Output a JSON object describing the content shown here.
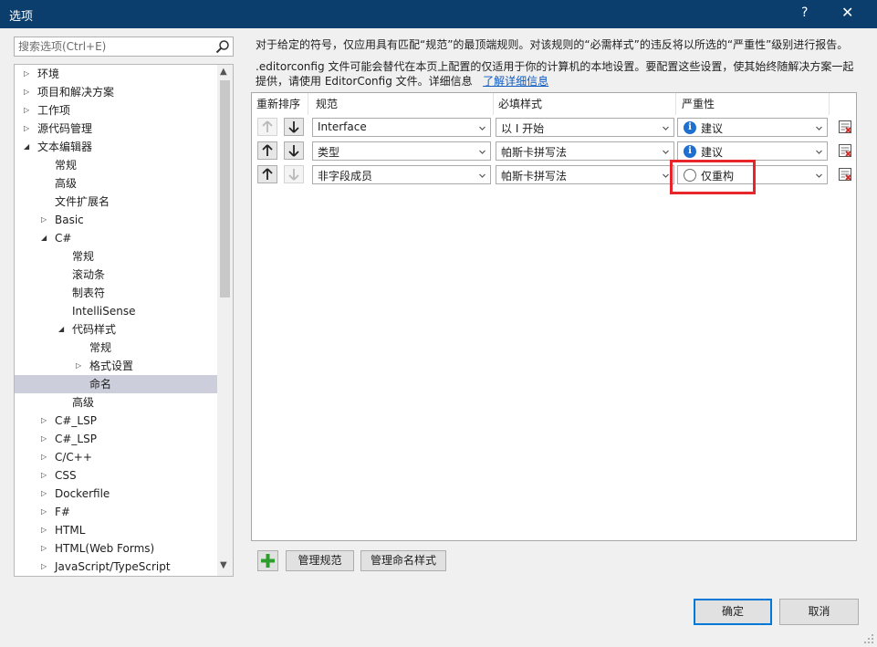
{
  "window": {
    "title": "选项",
    "help_label": "?",
    "close_label": "✕"
  },
  "search": {
    "placeholder": "搜索选项(Ctrl+E)"
  },
  "tree": {
    "items": [
      {
        "label": "环境",
        "level": 0,
        "arrow": "collapsed"
      },
      {
        "label": "项目和解决方案",
        "level": 0,
        "arrow": "collapsed"
      },
      {
        "label": "工作项",
        "level": 0,
        "arrow": "collapsed"
      },
      {
        "label": "源代码管理",
        "level": 0,
        "arrow": "collapsed"
      },
      {
        "label": "文本编辑器",
        "level": 0,
        "arrow": "expanded"
      },
      {
        "label": "常规",
        "level": 1,
        "arrow": "none"
      },
      {
        "label": "高级",
        "level": 1,
        "arrow": "none"
      },
      {
        "label": "文件扩展名",
        "level": 1,
        "arrow": "none"
      },
      {
        "label": "Basic",
        "level": 1,
        "arrow": "collapsed"
      },
      {
        "label": "C#",
        "level": 1,
        "arrow": "expanded"
      },
      {
        "label": "常规",
        "level": 2,
        "arrow": "none"
      },
      {
        "label": "滚动条",
        "level": 2,
        "arrow": "none"
      },
      {
        "label": "制表符",
        "level": 2,
        "arrow": "none"
      },
      {
        "label": "IntelliSense",
        "level": 2,
        "arrow": "none"
      },
      {
        "label": "代码样式",
        "level": 2,
        "arrow": "expanded"
      },
      {
        "label": "常规",
        "level": 3,
        "arrow": "none"
      },
      {
        "label": "格式设置",
        "level": 3,
        "arrow": "collapsed"
      },
      {
        "label": "命名",
        "level": 3,
        "arrow": "none",
        "selected": true
      },
      {
        "label": "高级",
        "level": 2,
        "arrow": "none"
      },
      {
        "label": "C#_LSP",
        "level": 1,
        "arrow": "collapsed"
      },
      {
        "label": "C#_LSP",
        "level": 1,
        "arrow": "collapsed"
      },
      {
        "label": "C/C++",
        "level": 1,
        "arrow": "collapsed"
      },
      {
        "label": "CSS",
        "level": 1,
        "arrow": "collapsed"
      },
      {
        "label": "Dockerfile",
        "level": 1,
        "arrow": "collapsed"
      },
      {
        "label": "F#",
        "level": 1,
        "arrow": "collapsed"
      },
      {
        "label": "HTML",
        "level": 1,
        "arrow": "collapsed"
      },
      {
        "label": "HTML(Web Forms)",
        "level": 1,
        "arrow": "collapsed"
      },
      {
        "label": "JavaScript/TypeScript",
        "level": 1,
        "arrow": "collapsed"
      }
    ]
  },
  "description": {
    "line1": "对于给定的符号，仅应用具有匹配“规范”的最顶端规则。对该规则的“必需样式”的违反将以所选的“严重性”级别进行报告。",
    "line2": ".editorconfig 文件可能会替代在本页上配置的仅适用于你的计算机的本地设置。要配置这些设置，使其始终随解决方案一起",
    "line3": "提供，请使用 EditorConfig 文件。详细信息",
    "learn_more": "了解详细信息"
  },
  "grid": {
    "headers": {
      "reorder": "重新排序",
      "spec": "规范",
      "style": "必填样式",
      "severity": "严重性"
    },
    "rows": [
      {
        "spec": "Interface",
        "style": "以 I 开始",
        "severity": "建议",
        "severity_icon": "info-icon",
        "up_enabled": false,
        "down_enabled": true
      },
      {
        "spec": "类型",
        "style": "帕斯卡拼写法",
        "severity": "建议",
        "severity_icon": "info-icon",
        "up_enabled": true,
        "down_enabled": true
      },
      {
        "spec": "非字段成员",
        "style": "帕斯卡拼写法",
        "severity": "仅重构",
        "severity_icon": "hollow-circle-icon",
        "up_enabled": true,
        "down_enabled": false
      }
    ]
  },
  "buttons": {
    "manage_specs": "管理规范",
    "manage_naming_styles": "管理命名样式",
    "ok": "确定",
    "cancel": "取消"
  },
  "colors": {
    "titlebar": "#0c3e6d",
    "selection": "#cccedb",
    "highlight_box": "#e8252a",
    "link": "#0f5bbf",
    "add_icon": "#2d9e2d"
  }
}
